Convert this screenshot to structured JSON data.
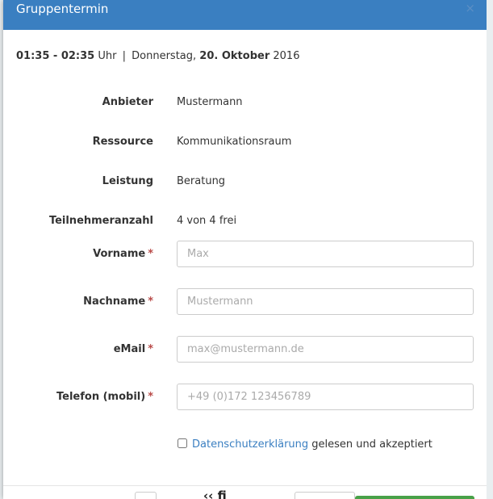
{
  "modal": {
    "title": "Gruppentermin",
    "close_label": "×"
  },
  "date": {
    "time_range": "01:35 - 02:35",
    "time_unit": "Uhr",
    "separator": "|",
    "weekday": "Donnerstag,",
    "day_month": "20. Oktober",
    "year": "2016"
  },
  "details": [
    {
      "label": "Anbieter",
      "value": "Mustermann"
    },
    {
      "label": "Ressource",
      "value": "Kommunikationsraum"
    },
    {
      "label": "Leistung",
      "value": "Beratung"
    },
    {
      "label": "Teilnehmeranzahl",
      "value": "4 von 4 frei"
    }
  ],
  "form": {
    "required_marker": "*",
    "first_name": {
      "label": "Vorname",
      "placeholder": "Max",
      "value": ""
    },
    "last_name": {
      "label": "Nachname",
      "placeholder": "Mustermann",
      "value": ""
    },
    "email": {
      "label": "eMail",
      "placeholder": "max@mustermann.de",
      "value": ""
    },
    "phone": {
      "label": "Telefon (mobil)",
      "placeholder": "+49 (0)172 123456789",
      "value": ""
    }
  },
  "privacy": {
    "link_text": "Datenschutzerklärung",
    "rest_text": " gelesen und akzeptiert",
    "checked": false
  },
  "footer": {
    "partial_text": "‹‹ fi"
  },
  "colors": {
    "header_bg": "#3a7fc1",
    "link": "#3a7fc1",
    "required": "#b94a48",
    "confirm_button": "#48a148"
  }
}
